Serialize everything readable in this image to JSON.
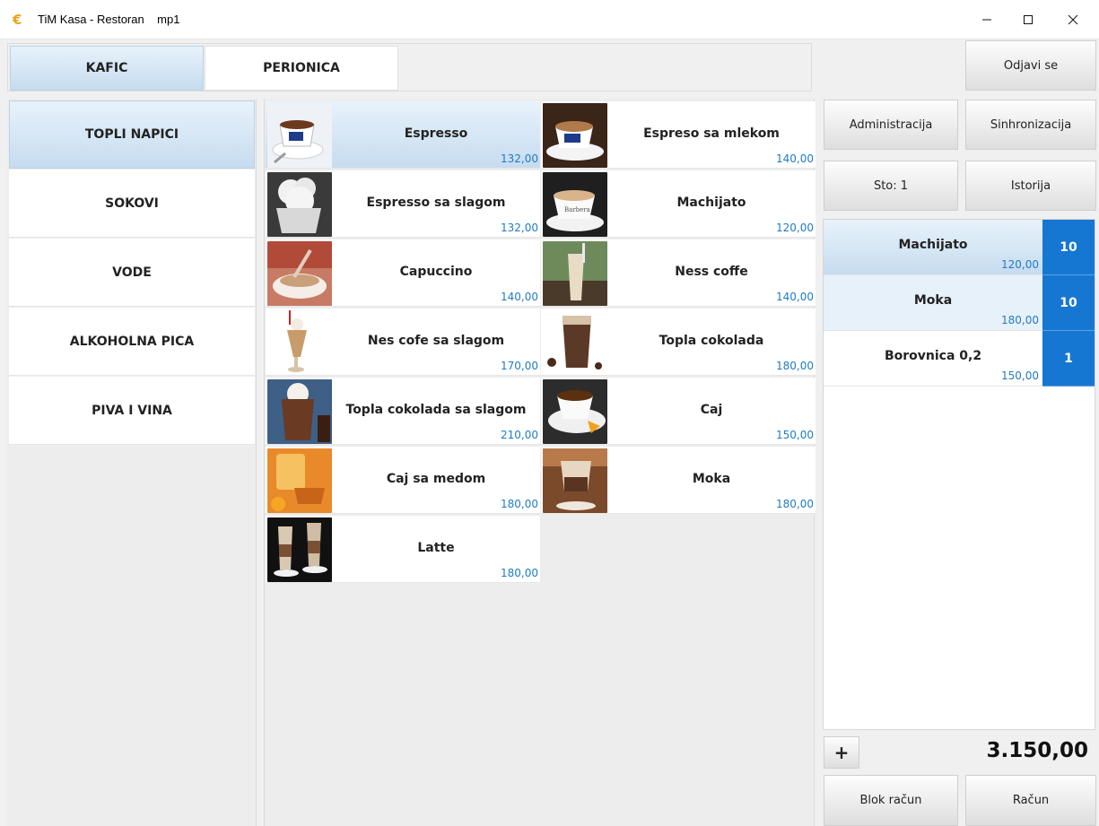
{
  "window": {
    "title": "TiM Kasa - Restoran    mp1",
    "minimize_glyph": "—",
    "maximize_glyph": "☐",
    "close_glyph": "✕"
  },
  "tabs": [
    {
      "label": "KAFIC",
      "active": true
    },
    {
      "label": "PERIONICA",
      "active": false
    }
  ],
  "categories": [
    {
      "label": "TOPLI NAPICI",
      "active": true
    },
    {
      "label": "SOKOVI",
      "active": false
    },
    {
      "label": "VODE",
      "active": false
    },
    {
      "label": "ALKOHOLNA PICA",
      "active": false
    },
    {
      "label": "PIVA I VINA",
      "active": false
    }
  ],
  "products": [
    {
      "name": "Espresso",
      "price": "132,00",
      "icon": "espresso-cup-icon"
    },
    {
      "name": "Espreso sa mlekom",
      "price": "140,00",
      "icon": "espresso-milk-icon"
    },
    {
      "name": "Espresso sa slagom",
      "price": "132,00",
      "icon": "whipped-cream-icon"
    },
    {
      "name": "Machijato",
      "price": "120,00",
      "icon": "macchiato-icon"
    },
    {
      "name": "Capuccino",
      "price": "140,00",
      "icon": "cappuccino-icon"
    },
    {
      "name": "Ness coffe",
      "price": "140,00",
      "icon": "iced-coffee-icon"
    },
    {
      "name": "Nes cofe sa slagom",
      "price": "170,00",
      "icon": "frappe-icon"
    },
    {
      "name": "Topla cokolada",
      "price": "180,00",
      "icon": "hot-chocolate-icon"
    },
    {
      "name": "Topla cokolada sa slagom",
      "price": "210,00",
      "icon": "chocolate-cream-icon"
    },
    {
      "name": "Caj",
      "price": "150,00",
      "icon": "tea-cup-icon"
    },
    {
      "name": "Caj sa medom",
      "price": "180,00",
      "icon": "honey-tea-icon"
    },
    {
      "name": "Moka",
      "price": "180,00",
      "icon": "mocha-glass-icon"
    },
    {
      "name": "Latte",
      "price": "180,00",
      "icon": "latte-glass-icon"
    }
  ],
  "buttons": {
    "logout": "Odjavi se",
    "admin": "Administracija",
    "sync": "Sinhronizacija",
    "table": "Sto: 1",
    "history": "Istorija",
    "plus": "+",
    "block_receipt": "Blok račun",
    "receipt": "Račun"
  },
  "order": {
    "items": [
      {
        "name": "Machijato",
        "price": "120,00",
        "qty": "10"
      },
      {
        "name": "Moka",
        "price": "180,00",
        "qty": "10"
      },
      {
        "name": "Borovnica 0,2",
        "price": "150,00",
        "qty": "1"
      }
    ],
    "total": "3.150,00"
  },
  "colors": {
    "accent": "#1677d2",
    "price": "#1f7bc4",
    "selected_bg": "#c6dcef"
  }
}
